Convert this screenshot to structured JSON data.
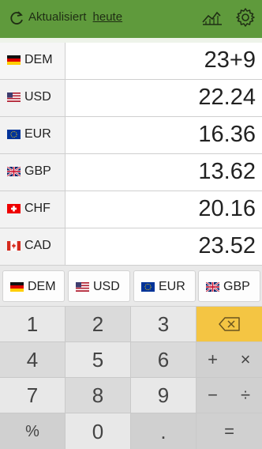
{
  "header": {
    "status_text": "Aktualisiert",
    "status_link": "heute",
    "icons": [
      "refresh-icon",
      "chart-icon",
      "gear-icon"
    ]
  },
  "colors": {
    "header_green": "#5f9a3c",
    "backspace_key": "#f4c543"
  },
  "rows": [
    {
      "code": "DEM",
      "value": "23+9",
      "flag": "de-flag-icon"
    },
    {
      "code": "USD",
      "value": "22.24",
      "flag": "us-flag-icon"
    },
    {
      "code": "EUR",
      "value": "16.36",
      "flag": "eu-flag-icon"
    },
    {
      "code": "GBP",
      "value": "13.62",
      "flag": "gb-flag-icon"
    },
    {
      "code": "CHF",
      "value": "20.16",
      "flag": "ch-flag-icon"
    },
    {
      "code": "CAD",
      "value": "23.52",
      "flag": "ca-flag-icon"
    }
  ],
  "tabs": [
    {
      "code": "DEM",
      "flag": "de-flag-icon"
    },
    {
      "code": "USD",
      "flag": "us-flag-icon"
    },
    {
      "code": "EUR",
      "flag": "eu-flag-icon"
    },
    {
      "code": "GBP",
      "flag": "gb-flag-icon"
    }
  ],
  "keypad": {
    "k1": "1",
    "k2": "2",
    "k3": "3",
    "k4": "4",
    "k5": "5",
    "k6": "6",
    "k7": "7",
    "k8": "8",
    "k9": "9",
    "percent": "%",
    "k0": "0",
    "dot": ".",
    "plus": "+",
    "times": "×",
    "minus": "−",
    "divide": "÷",
    "equals": "="
  }
}
